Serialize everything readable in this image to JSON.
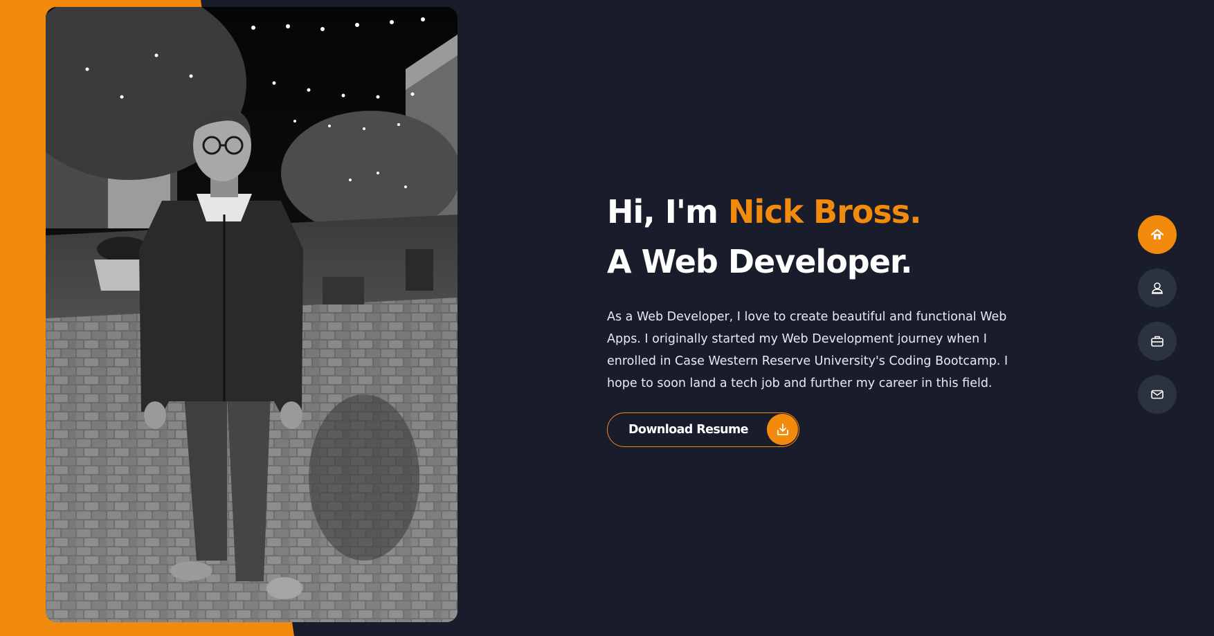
{
  "hero": {
    "greeting_prefix": "Hi, I'm ",
    "name": "Nick Bross.",
    "role": "A Web Developer.",
    "description": "As a Web Developer, I love to create beautiful and functional Web Apps. I originally started my Web Development journey when I enrolled in Case Western Reserve University's Coding Bootcamp. I hope to soon land a tech job and further my career in this field.",
    "resume_button_label": "Download Resume",
    "resume_button_icon": "download-icon"
  },
  "side_nav": {
    "items": [
      {
        "icon": "home-icon",
        "active": true
      },
      {
        "icon": "person-icon",
        "active": false
      },
      {
        "icon": "briefcase-icon",
        "active": false
      },
      {
        "icon": "envelope-icon",
        "active": false
      }
    ]
  },
  "colors": {
    "accent": "#f28a0d",
    "background": "#181c2b",
    "nav_inactive": "#2b3340",
    "text": "#ffffff"
  }
}
